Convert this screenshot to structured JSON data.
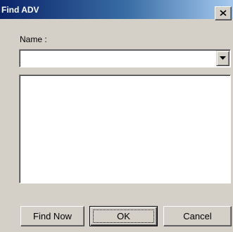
{
  "window": {
    "title": "Find ADV"
  },
  "form": {
    "name_label": "Name :",
    "name_value": ""
  },
  "results": {
    "items": []
  },
  "buttons": {
    "find_now": "Find Now",
    "ok": "OK",
    "cancel": "Cancel"
  },
  "icons": {
    "close": "close-icon",
    "dropdown": "chevron-down-icon"
  }
}
